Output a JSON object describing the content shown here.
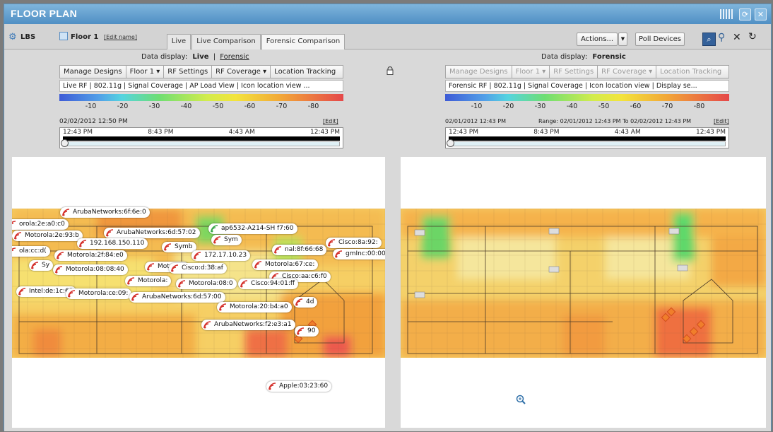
{
  "title": "FLOOR PLAN",
  "toolbar": {
    "lbs": "LBS",
    "floor": "Floor 1",
    "edit_name": "[Edit name]",
    "tabs": [
      "Live",
      "Live Comparison",
      "Forensic Comparison"
    ],
    "actions": "Actions...",
    "poll": "Poll Devices"
  },
  "left": {
    "data_display_label": "Data display:",
    "mode_live": "Live",
    "mode_sep": "|",
    "mode_forensic": "Forensic",
    "menu": [
      "Manage Designs",
      "Floor 1",
      "RF Settings",
      "RF Coverage",
      "Location Tracking"
    ],
    "display_line": "Live RF  |  802.11g  |  Signal Coverage  |  AP Load View  |  Icon location view  ...",
    "scale_ticks": [
      "-10",
      "-20",
      "-30",
      "-40",
      "-50",
      "-60",
      "-70",
      "-80"
    ],
    "date_text": "02/02/2012 12:50 PM",
    "edit": "[Edit]",
    "timeline": [
      "12:43 PM",
      "8:43 PM",
      "4:43 AM",
      "12:43 PM"
    ]
  },
  "right": {
    "data_display_label": "Data display:",
    "mode": "Forensic",
    "menu": [
      "Manage Designs",
      "Floor 1",
      "RF Settings",
      "RF Coverage",
      "Location Tracking"
    ],
    "display_line": "Forensic RF  |  802.11g  |  Signal Coverage  |  Icon location view  |  Display se...",
    "scale_ticks": [
      "-10",
      "-20",
      "-30",
      "-40",
      "-50",
      "-60",
      "-70",
      "-80"
    ],
    "date_text": "02/01/2012 12:43 PM",
    "range_text": "Range: 02/01/2012 12:43 PM To 02/02/2012 12:43 PM",
    "edit": "[Edit]",
    "timeline": [
      "12:43 PM",
      "8:43 PM",
      "4:43 AM",
      "12:43 PM"
    ]
  },
  "tags": [
    "ArubaNetworks:6f:6e:0",
    "orola:2e:a0:c0",
    "Motorola:2e:93:b",
    "ArubaNetworks:6d:57:02",
    "ap6532-A214-SH f7:60",
    "192.168.150.110",
    "Symb",
    "Sym",
    "nal:8f:66:68",
    "Cisco:8a:92:",
    "ola:cc:d(",
    "Motorola:2f:84:e0",
    "172.17.10.23",
    "gmInc:00:00:",
    "Motorola:08:08:40",
    "Motorola",
    "Cisco:d:38:af",
    "Motorola:67:ce:",
    "Sy",
    "Cisco:aa:c6:f0",
    "Motorola:",
    "Motorola:08:0",
    "Cisco:94:01:ff",
    "Intel:de:1c:68",
    "Motorola:ce:09:",
    "ArubaNetworks:6d:57:00",
    "Motorola:20:b4:a0",
    "4d",
    "ArubaNetworks:f2:e3:a1",
    "90",
    "Apple:03:23:60"
  ],
  "colors": {
    "titlebar": "#4f8fc4",
    "heat_warm": "#f6b84a",
    "heat_yellow": "#f4e265",
    "heat_green": "#5fd86a",
    "heat_red": "#ec5656"
  }
}
